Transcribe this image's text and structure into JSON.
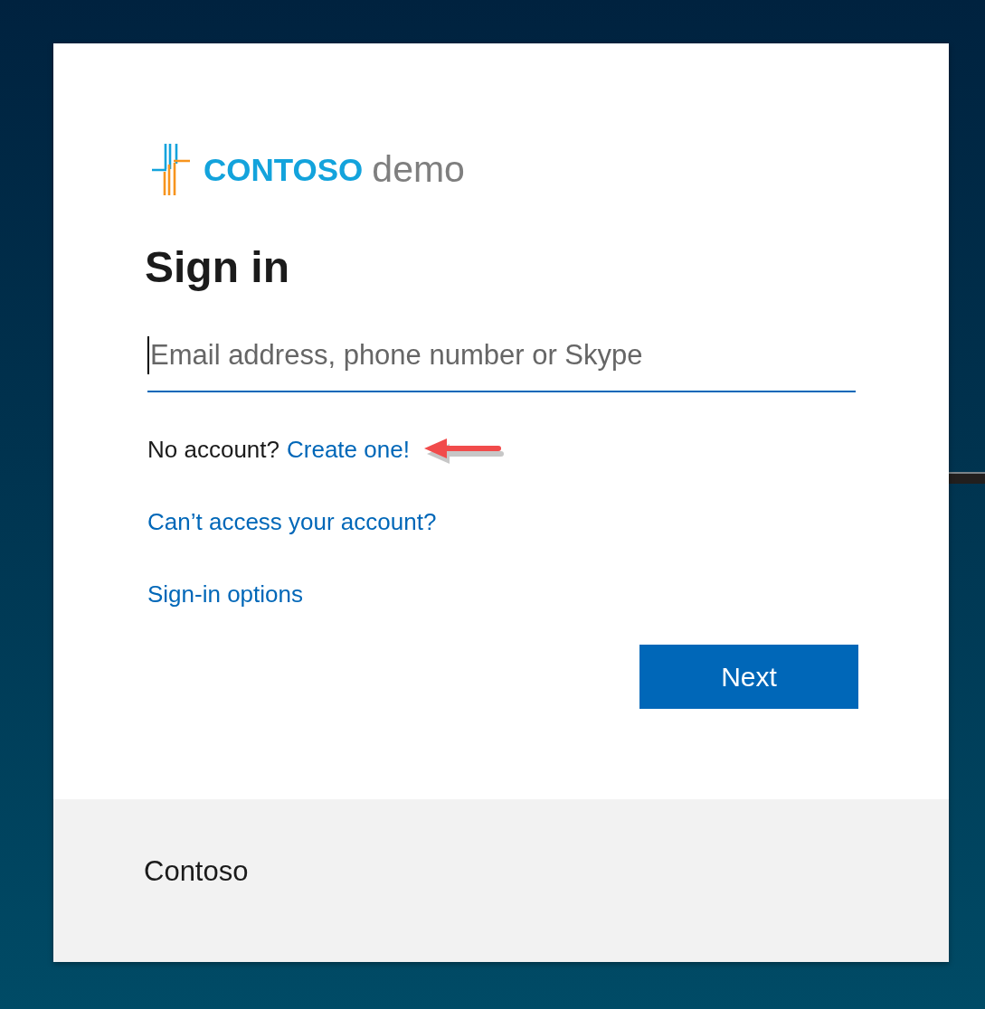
{
  "logo": {
    "brand": "CONTOSO",
    "suffix": "demo"
  },
  "title": "Sign in",
  "email_field": {
    "placeholder": "Email address, phone number or Skype",
    "focused": true
  },
  "signup": {
    "prompt": "No account?",
    "link": "Create one!"
  },
  "links": [
    "Can’t access your account?",
    "Sign-in options"
  ],
  "next_button": {
    "label": "Next"
  },
  "footer": {
    "text": "Contoso"
  }
}
